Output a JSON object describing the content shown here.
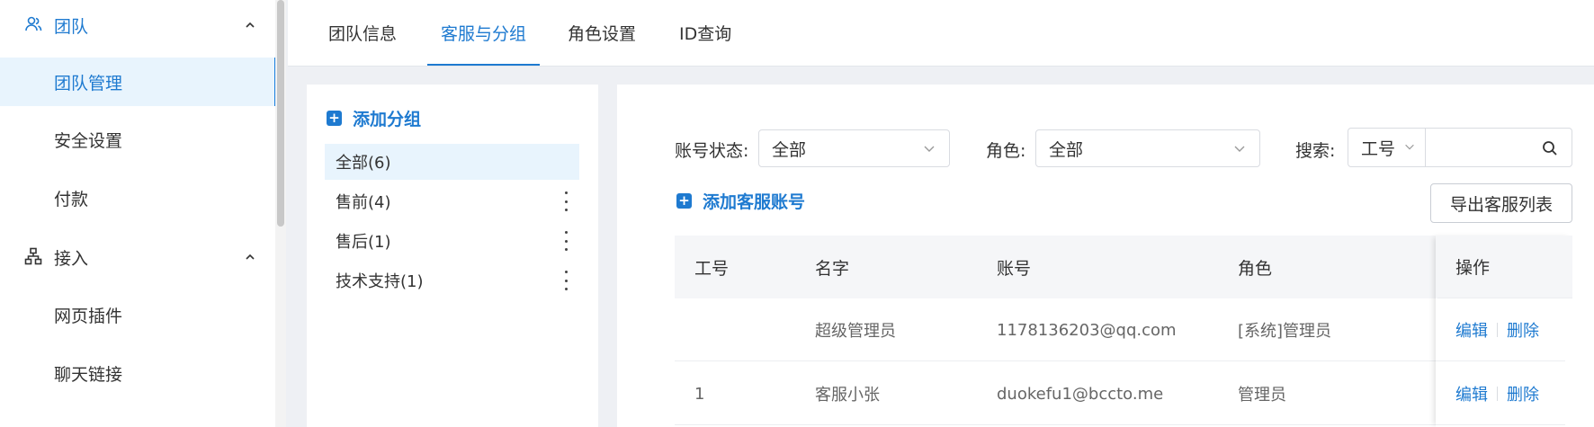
{
  "sidebar": {
    "groups": [
      {
        "label": "团队",
        "icon": "team-icon",
        "color": "#1e7ad0"
      },
      {
        "label": "接入",
        "icon": "access-icon",
        "color": "#333333"
      }
    ],
    "items": [
      {
        "label": "团队管理",
        "active": true
      },
      {
        "label": "安全设置"
      },
      {
        "label": "付款"
      },
      {
        "label": "网页插件"
      },
      {
        "label": "聊天链接"
      }
    ]
  },
  "tabs": [
    {
      "label": "团队信息"
    },
    {
      "label": "客服与分组",
      "active": true
    },
    {
      "label": "角色设置"
    },
    {
      "label": "ID查询"
    }
  ],
  "groups_panel": {
    "add_label": "添加分组",
    "items": [
      {
        "label": "全部(6)",
        "active": true
      },
      {
        "label": "售前(4)"
      },
      {
        "label": "售后(1)"
      },
      {
        "label": "技术支持(1)"
      }
    ]
  },
  "filters": {
    "status_label": "账号状态:",
    "status_value": "全部",
    "role_label": "角色:",
    "role_value": "全部",
    "search_label": "搜索:",
    "search_type": "工号",
    "search_value": ""
  },
  "actions": {
    "add_agent": "添加客服账号",
    "export": "导出客服列表"
  },
  "table": {
    "columns": [
      "工号",
      "名字",
      "账号",
      "角色",
      "操作"
    ],
    "rows": [
      {
        "id": "",
        "name": "超级管理员",
        "account": "1178136203@qq.com",
        "role": "[系统]管理员",
        "edit": "编辑",
        "delete": "删除"
      },
      {
        "id": "1",
        "name": "客服小张",
        "account": "duokefu1@bccto.me",
        "role": "管理员",
        "edit": "编辑",
        "delete": "删除"
      }
    ]
  },
  "colors": {
    "accent": "#1e7ad0",
    "active_bg": "#e8f4fd"
  }
}
